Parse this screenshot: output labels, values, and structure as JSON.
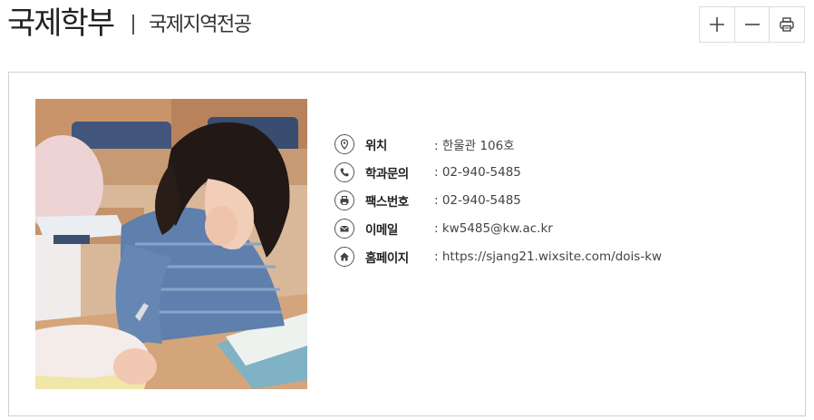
{
  "header": {
    "title": "국제학부",
    "subtitle": "국제지역전공"
  },
  "toolbar": {
    "zoom_in_icon": "plus-icon",
    "zoom_out_icon": "minus-icon",
    "print_icon": "printer-icon"
  },
  "info": {
    "rows": [
      {
        "icon": "location-pin-icon",
        "label": "위치",
        "value": ": 한울관 106호"
      },
      {
        "icon": "phone-icon",
        "label": "학과문의",
        "value": ": 02-940-5485"
      },
      {
        "icon": "fax-icon",
        "label": "팩스번호",
        "value": ": 02-940-5485"
      },
      {
        "icon": "mail-icon",
        "label": "이메일",
        "value": ": kw5485@kw.ac.kr"
      },
      {
        "icon": "home-icon",
        "label": "홈페이지",
        "value": ": https://sjang21.wixsite.com/dois-kw"
      }
    ]
  }
}
